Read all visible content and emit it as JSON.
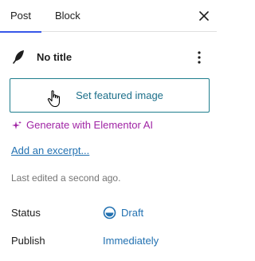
{
  "tabs": {
    "post": "Post",
    "block": "Block"
  },
  "icons": {
    "close": "close-icon",
    "feather": "feather-icon",
    "more": "vertical-ellipsis-icon",
    "sparkle": "sparkle-icon",
    "status": "draft-status-icon",
    "cursor": "hand-pointer-icon"
  },
  "post": {
    "title": "No title"
  },
  "featured_image": {
    "label": "Set featured image"
  },
  "elementor": {
    "label": "Generate with Elementor AI"
  },
  "excerpt": {
    "label": "Add an excerpt..."
  },
  "meta": {
    "last_edited": "Last edited a second ago."
  },
  "status": {
    "label": "Status",
    "value": "Draft"
  },
  "publish": {
    "label": "Publish",
    "value": "Immediately"
  },
  "colors": {
    "accent_tab": "#3858e9",
    "link": "#2271b1",
    "elementor": "#a025a5",
    "button_border": "#1f7e8e"
  }
}
